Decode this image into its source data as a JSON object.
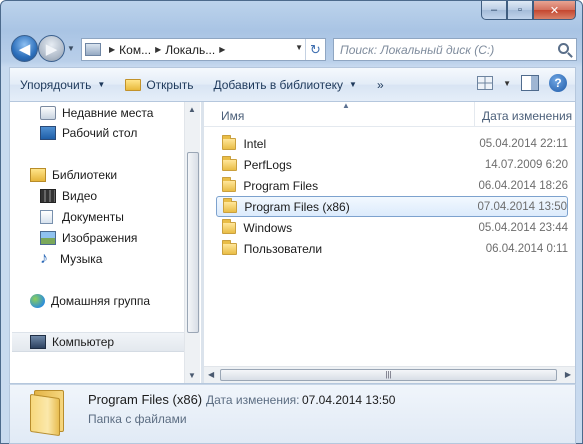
{
  "window": {
    "minimize_icon": "minimize-icon",
    "maximize_icon": "maximize-icon",
    "close_icon": "close-icon",
    "minimize_glyph": "‒",
    "maximize_glyph": "▫",
    "close_glyph": "✕"
  },
  "navigation": {
    "back_glyph": "◀",
    "forward_glyph": "▶",
    "breadcrumb": [
      "Ком...",
      "Локаль..."
    ],
    "search_placeholder": "Поиск: Локальный диск (C:)"
  },
  "toolbar": {
    "organize": "Упорядочить",
    "open": "Открыть",
    "add_to_library": "Добавить в библиотеку",
    "more": "»",
    "help": "?"
  },
  "sidebar": {
    "items": [
      {
        "label": "Недавние места",
        "icon": "recent-places-icon"
      },
      {
        "label": "Рабочий стол",
        "icon": "desktop-icon"
      },
      {
        "label": "Библиотеки",
        "icon": "libraries-icon"
      },
      {
        "label": "Видео",
        "icon": "video-icon"
      },
      {
        "label": "Документы",
        "icon": "documents-icon"
      },
      {
        "label": "Изображения",
        "icon": "pictures-icon"
      },
      {
        "label": "Музыка",
        "icon": "music-icon"
      },
      {
        "label": "Домашняя группа",
        "icon": "homegroup-icon"
      },
      {
        "label": "Компьютер",
        "icon": "computer-icon"
      }
    ]
  },
  "file_list": {
    "columns": {
      "name": "Имя",
      "date": "Дата изменения"
    },
    "rows": [
      {
        "name": "Intel",
        "date": "05.04.2014 22:11"
      },
      {
        "name": "PerfLogs",
        "date": "14.07.2009 6:20"
      },
      {
        "name": "Program Files",
        "date": "06.04.2014 18:26"
      },
      {
        "name": "Program Files (x86)",
        "date": "07.04.2014 13:50"
      },
      {
        "name": "Windows",
        "date": "05.04.2014 23:44"
      },
      {
        "name": "Пользователи",
        "date": "06.04.2014 0:11"
      }
    ],
    "selected_index": 3
  },
  "details": {
    "name": "Program Files (x86)",
    "type": "Папка с файлами",
    "modified_label": "Дата изменения:",
    "modified_value": "07.04.2014 13:50"
  },
  "colors": {
    "selection_border": "#7da2ce",
    "selection_fill": "#dcebfc",
    "text_blue": "#1e395b"
  }
}
